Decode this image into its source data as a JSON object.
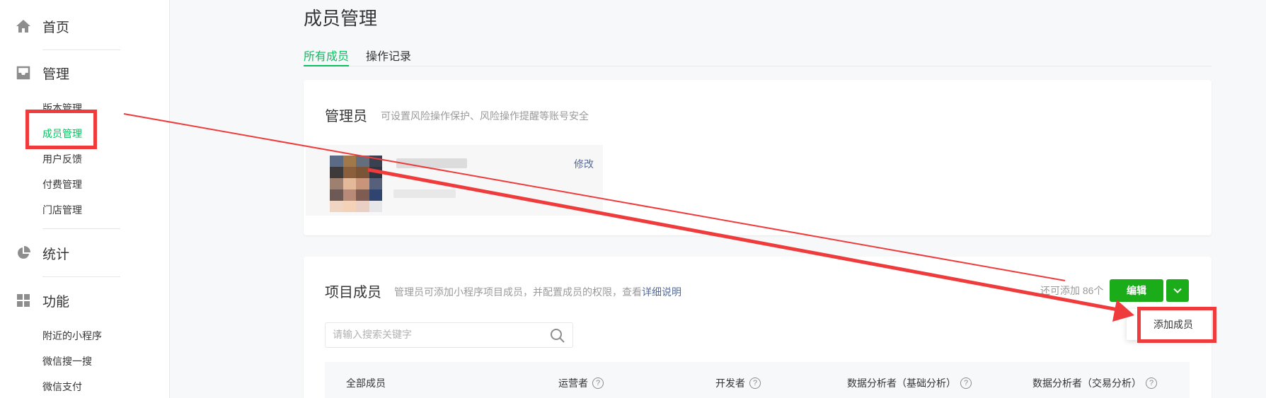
{
  "sidebar": {
    "home": {
      "label": "首页",
      "icon": "home-icon"
    },
    "manage": {
      "label": "管理",
      "icon": "inbox-icon",
      "items": [
        "版本管理",
        "成员管理",
        "用户反馈",
        "付费管理",
        "门店管理"
      ],
      "active_index": 1
    },
    "stats": {
      "label": "统计",
      "icon": "pie-chart-icon"
    },
    "features": {
      "label": "功能",
      "icon": "grid-icon",
      "items": [
        "附近的小程序",
        "微信搜一搜",
        "微信支付"
      ]
    }
  },
  "page": {
    "title": "成员管理"
  },
  "tabs": [
    {
      "label": "所有成员",
      "active": true
    },
    {
      "label": "操作记录",
      "active": false
    }
  ],
  "admin_card": {
    "title": "管理员",
    "desc": "可设置风险操作保护、风险操作提醒等账号安全",
    "edit_label": "修改"
  },
  "members_card": {
    "title": "项目成员",
    "desc": "管理员可添加小程序项目成员，并配置成员的权限，查看",
    "desc_link": "详细说明",
    "quota": "还可添加 86个",
    "edit_button": "编辑",
    "dropdown_item": "添加成员",
    "search_placeholder": "请输入搜索关键字",
    "columns": [
      "全部成员",
      "运营者",
      "开发者",
      "数据分析者（基础分析）",
      "数据分析者（交易分析）"
    ]
  },
  "colors": {
    "accent": "#07c160",
    "button": "#1aad19",
    "link": "#576b95",
    "annotation": "#ef3b3b"
  }
}
